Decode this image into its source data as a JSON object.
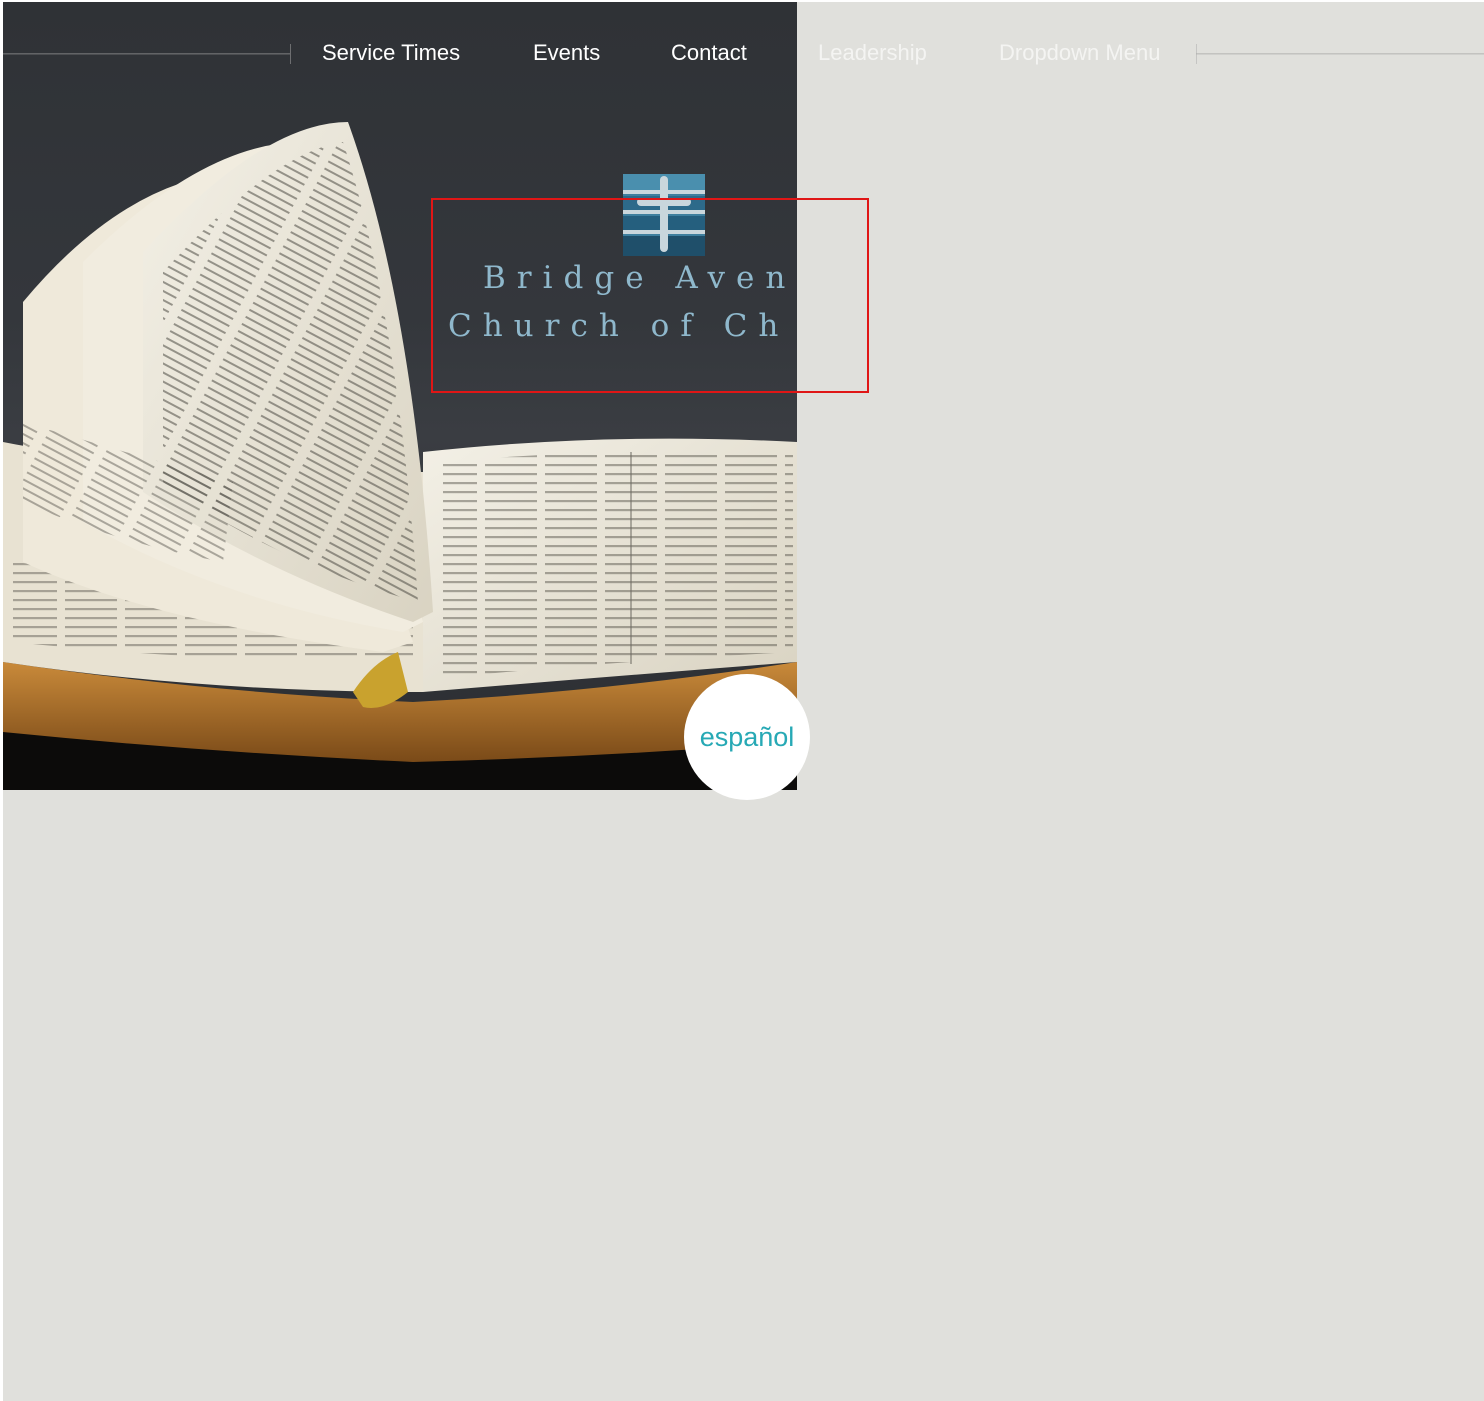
{
  "nav": {
    "items": [
      {
        "label": "Service Times"
      },
      {
        "label": "Events"
      },
      {
        "label": "Contact"
      },
      {
        "label": "Leadership"
      },
      {
        "label": "Dropdown Menu"
      }
    ]
  },
  "logo": {
    "line1": "Bridge Aven",
    "line2": "Church of Ch",
    "icon": "cross-bridge-logo-icon"
  },
  "hero": {
    "image": "open-bible-photo"
  },
  "language_button": {
    "label": "español"
  },
  "colors": {
    "page_background": "#e0e0dc",
    "accent": "#27a9b5",
    "logo_text": "#8fb8cc",
    "highlight": "#e01616"
  }
}
